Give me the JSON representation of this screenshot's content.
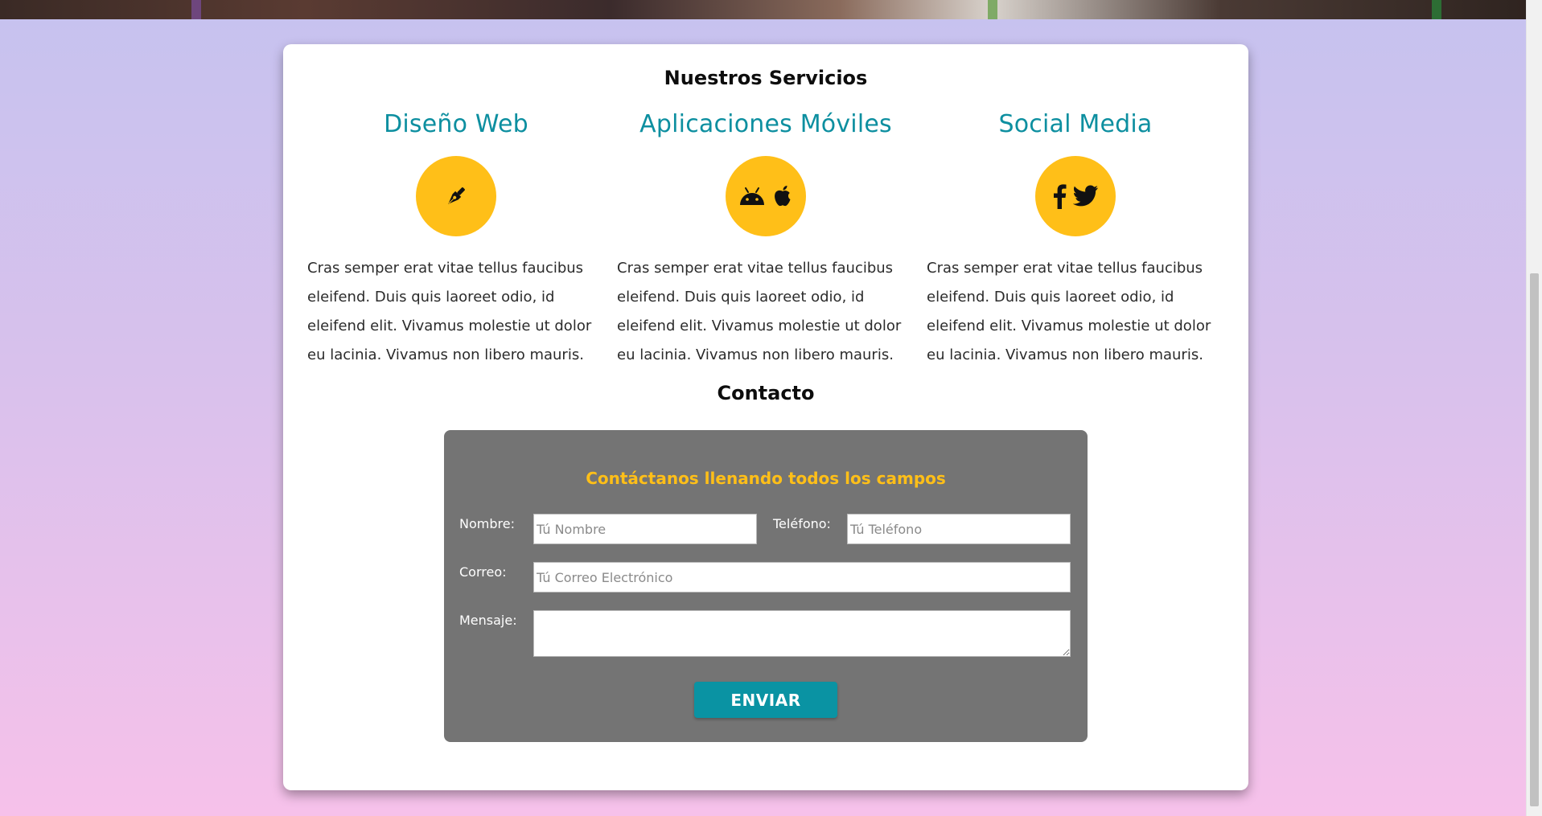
{
  "colors": {
    "accent": "#0d8fa0",
    "icon_circle": "#ffbf18",
    "form_background": "#747474",
    "form_heading": "#ffbf18",
    "button": "#0a93a3"
  },
  "services": {
    "title": "Nuestros Servicios",
    "items": [
      {
        "title": "Diseño Web",
        "icons": [
          "pen-nib-icon"
        ],
        "text": "Cras semper erat vitae tellus faucibus eleifend. Duis quis laoreet odio, id eleifend elit. Vivamus molestie ut dolor eu lacinia. Vivamus non libero mauris."
      },
      {
        "title": "Aplicaciones Móviles",
        "icons": [
          "android-icon",
          "apple-icon"
        ],
        "text": "Cras semper erat vitae tellus faucibus eleifend. Duis quis laoreet odio, id eleifend elit. Vivamus molestie ut dolor eu lacinia. Vivamus non libero mauris."
      },
      {
        "title": "Social Media",
        "icons": [
          "facebook-icon",
          "twitter-icon"
        ],
        "text": "Cras semper erat vitae tellus faucibus eleifend. Duis quis laoreet odio, id eleifend elit. Vivamus molestie ut dolor eu lacinia. Vivamus non libero mauris."
      }
    ]
  },
  "contact": {
    "title": "Contacto",
    "form": {
      "heading": "Contáctanos llenando todos los campos",
      "name_label": "Nombre:",
      "name_placeholder": "Tú Nombre",
      "phone_label": "Teléfono:",
      "phone_placeholder": "Tú Teléfono",
      "email_label": "Correo:",
      "email_placeholder": "Tú Correo Electrónico",
      "message_label": "Mensaje:",
      "message_placeholder": "",
      "submit_label": "ENVIAR"
    }
  }
}
